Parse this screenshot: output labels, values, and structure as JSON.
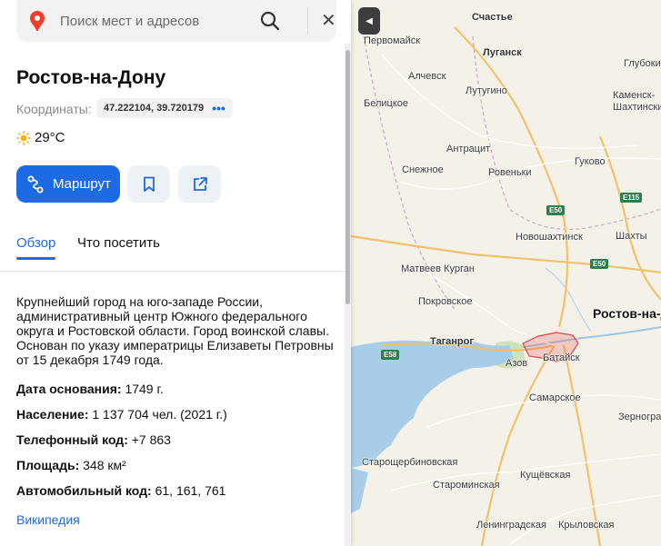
{
  "search": {
    "placeholder": "Поиск мест и адресов"
  },
  "place": {
    "title": "Ростов-на-Дону",
    "coords_label": "Координаты:",
    "coords_value": "47.222104, 39.720179",
    "coords_more": "•••",
    "temperature": "29°C"
  },
  "actions": {
    "route_label": "Маршрут"
  },
  "tabs": [
    {
      "label": "Обзор"
    },
    {
      "label": "Что посетить"
    }
  ],
  "description": "Крупнейший город на юго-западе России, административный центр Южного федерального округа и Ростовской области. Город воинской славы. Основан по указу императрицы Елизаветы Петровны от 15 декабря 1749 года.",
  "facts": [
    {
      "key": "Дата основания:",
      "value": "1749 г."
    },
    {
      "key": "Население:",
      "value": "1 137 704 чел. (2021 г.)"
    },
    {
      "key": "Телефонный код:",
      "value": "+7 863"
    },
    {
      "key": "Площадь:",
      "value": "348 км²"
    },
    {
      "key": "Автомобильный код:",
      "value": "61, 161, 761"
    }
  ],
  "wiki_link": "Википедия",
  "map": {
    "selected_label": "Ростов-на-Дону",
    "cities": [
      "Счастье",
      "Первомайск",
      "Луганск",
      "Глубокий",
      "Алчевск",
      "Лутугино",
      "Белицкое",
      "Каменск-Шахтинский",
      "Антрацит",
      "Снежное",
      "Ровеньки",
      "Гуково",
      "Новошахтинск",
      "Шахты",
      "Матвеев Курган",
      "Покровское",
      "Таганрог",
      "Азов",
      "Батайск",
      "Самарское",
      "Зерноград",
      "Староминская",
      "Кущёвская",
      "Ленинградская",
      "Крыловская",
      "Старощербиновская"
    ],
    "roads": [
      "E115",
      "E50",
      "E50",
      "E58"
    ],
    "colors": {
      "water": "#a8cde8",
      "land": "#f4f1e8",
      "accent": "#1d6ae5",
      "pin": "#e8201d"
    }
  }
}
